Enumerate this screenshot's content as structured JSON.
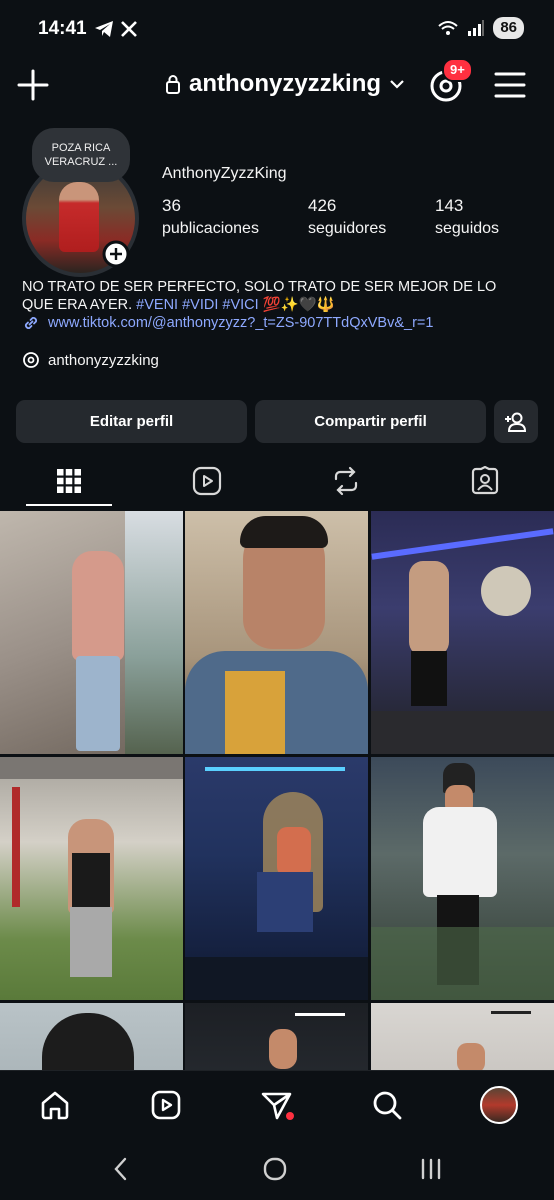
{
  "status_bar": {
    "time": "14:41",
    "battery": "86",
    "icons": [
      "telegram-icon",
      "x-icon",
      "wifi-icon",
      "signal-icon"
    ]
  },
  "header": {
    "username": "anthonyzyzzking",
    "threads_badge": "9+"
  },
  "profile": {
    "note": "POZA RICA VERACRUZ ...",
    "display_name": "AnthonyZyzzKing",
    "stats": [
      {
        "value": "36",
        "label": "publicaciones"
      },
      {
        "value": "426",
        "label": "seguidores"
      },
      {
        "value": "143",
        "label": "seguidos"
      }
    ],
    "bio_text": "NO TRATO DE SER PERFECTO, SOLO TRATO DE SER MEJOR DE LO QUE ERA AYER.",
    "bio_hashtags": "#VENI #VIDI #VICI",
    "bio_emojis": "💯✨🖤🔱",
    "link": "www.tiktok.com/@anthonyzyzz?_t=ZS-907TTdQxVBv&_r=1",
    "threads_handle": "anthonyzyzzking"
  },
  "actions": {
    "edit_profile": "Editar perfil",
    "share_profile": "Compartir perfil"
  },
  "tabs": [
    "grid-icon",
    "reels-icon",
    "reposts-icon",
    "tagged-icon"
  ],
  "colors": {
    "background": "#0c1014",
    "button_bg": "#25292e",
    "link": "#8ea9ff",
    "badge": "#ff3040"
  }
}
